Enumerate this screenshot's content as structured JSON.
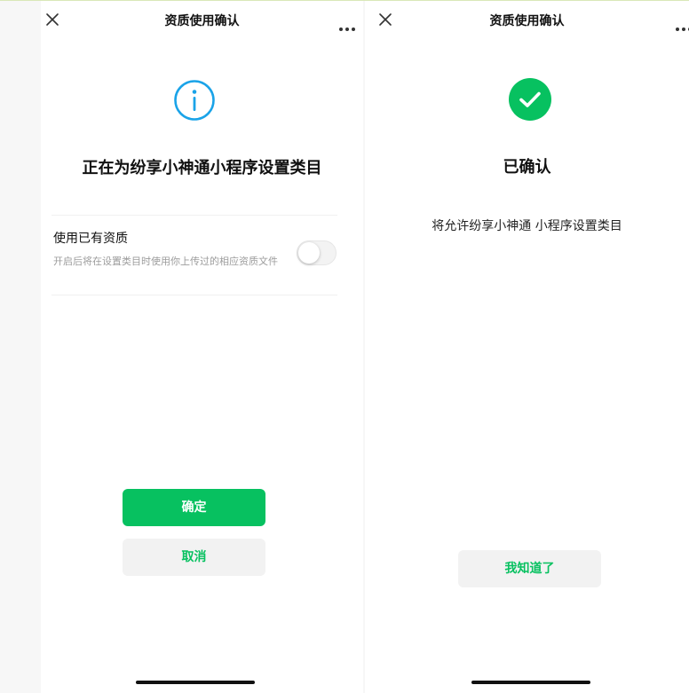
{
  "colors": {
    "accent_green": "#07c160",
    "info_blue": "#1aa3e8",
    "secondary_button_bg": "#f2f2f2",
    "hint_gray": "#9c9c9c"
  },
  "left_screen": {
    "nav": {
      "title": "资质使用确认",
      "close_icon": "close-icon",
      "more_icon": "more-icon"
    },
    "status_icon": "info-icon",
    "heading": "正在为纷享小神通小程序设置类目",
    "setting": {
      "label": "使用已有资质",
      "hint": "开启后将在设置类目时使用你上传过的相应资质文件",
      "toggle_on": false
    },
    "buttons": {
      "confirm": "确定",
      "cancel": "取消"
    }
  },
  "right_screen": {
    "nav": {
      "title": "资质使用确认",
      "close_icon": "close-icon",
      "more_icon": "more-icon"
    },
    "status_icon": "check-circle-icon",
    "heading": "已确认",
    "description": "将允许纷享小神通 小程序设置类目",
    "buttons": {
      "got_it": "我知道了"
    }
  }
}
